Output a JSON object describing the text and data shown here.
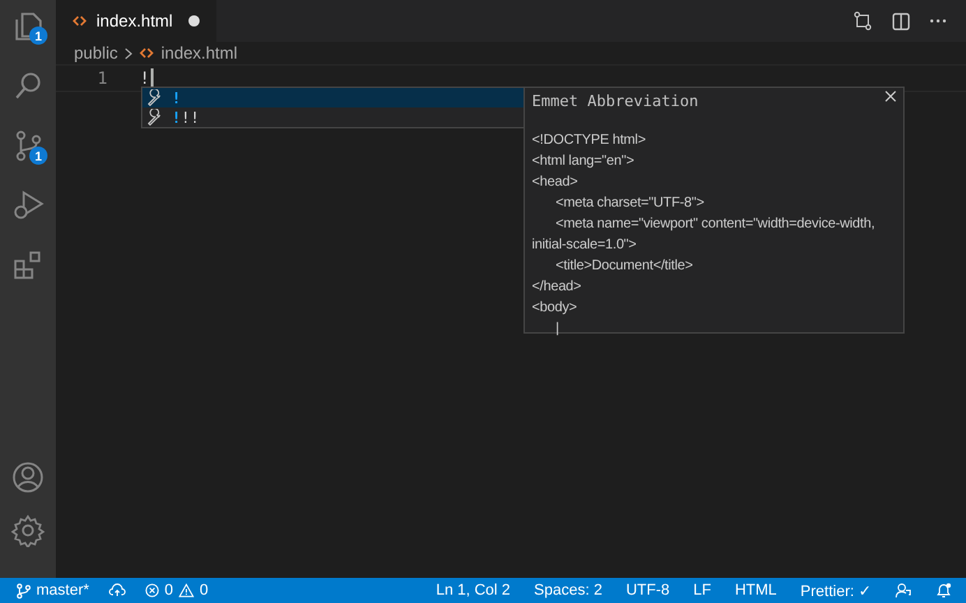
{
  "activity_bar": {
    "items": [
      {
        "kind": "explorer",
        "badge": "1"
      },
      {
        "kind": "search"
      },
      {
        "kind": "scm",
        "badge": "1"
      },
      {
        "kind": "debug"
      },
      {
        "kind": "extensions"
      }
    ],
    "bottom_items": [
      {
        "kind": "account"
      },
      {
        "kind": "settings"
      }
    ]
  },
  "tabs": [
    {
      "label": "index.html",
      "selected": true,
      "modified": true
    }
  ],
  "breadcrumbs": [
    "public",
    "index.html"
  ],
  "editor": {
    "lines": [
      {
        "number": "1",
        "text": "!"
      }
    ]
  },
  "suggestions": [
    {
      "match": "!",
      "selected": true
    },
    {
      "match": "!",
      "rest": "!!",
      "selected": false
    }
  ],
  "details": {
    "title": "Emmet Abbreviation",
    "code": [
      {
        "text": "<!DOCTYPE html>"
      },
      {
        "text": "<html lang=\"en\">"
      },
      {
        "text": "<head>",
        "children": [
          {
            "text": "<meta charset=\"UTF-8\">"
          },
          {
            "text": "<meta name=\"viewport\" content=\"width=device-width, initial-scale=1.0\">"
          },
          {
            "text": "<title>Document</title>"
          }
        ]
      },
      {
        "text": "</head>"
      },
      {
        "text": "<body>",
        "children": [
          {
            "text": "|"
          }
        ]
      }
    ]
  },
  "status_bar": {
    "branch": "master*",
    "errors": "0",
    "warnings": "0",
    "items": [
      "Ln 1, Col 2",
      "Spaces: 2",
      "UTF-8",
      "LF",
      "HTML",
      "Prettier: ✓"
    ]
  }
}
